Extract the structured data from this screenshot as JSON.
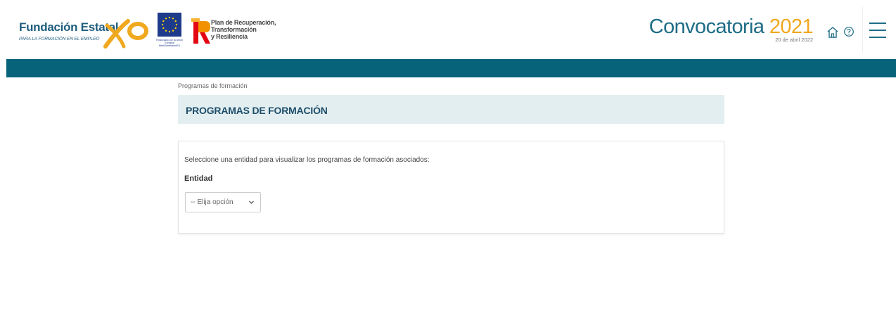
{
  "header": {
    "brand_title": "Fundación Estatal",
    "brand_subtitle": "PARA LA FORMACIÓN EN EL EMPLEO",
    "eu_caption": "Financiado por la Unión Europea NextGenerationEU",
    "prtr_lines": [
      "Plan de Recuperación,",
      "Transformación",
      "y Resiliencia"
    ],
    "convocatoria_label": "Convocatoria",
    "convocatoria_year": "2021",
    "date": "20 de abril 2022",
    "icons": [
      "home-icon",
      "help-icon",
      "menu-icon"
    ]
  },
  "colors": {
    "brand": "#1f5e7e",
    "accent": "#f0a81e",
    "teal_bar": "#07637a",
    "title_bg": "#e3eef0"
  },
  "breadcrumb": "Programas de formación",
  "page_title": "PROGRAMAS DE FORMACIÓN",
  "form": {
    "intro": "Seleccione una entidad para visualizar los programas de formación asociados:",
    "entity_label": "Entidad",
    "entity_selected": "-- Elija opción"
  }
}
